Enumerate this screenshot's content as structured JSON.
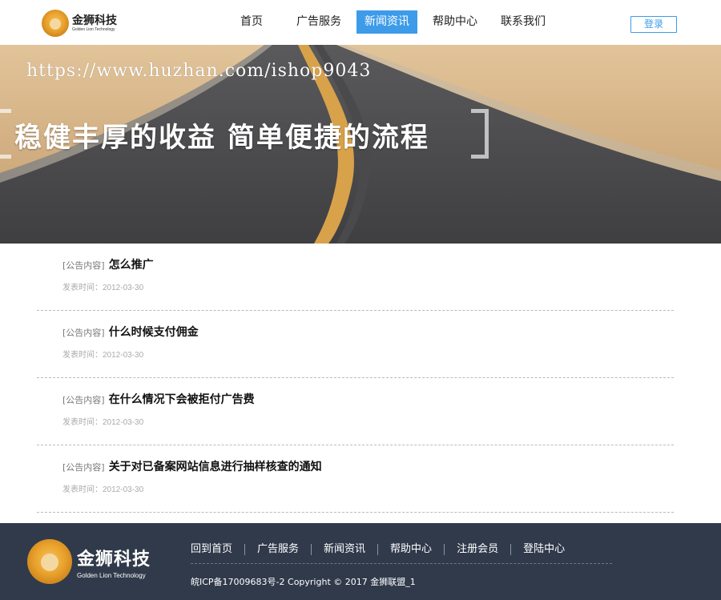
{
  "header": {
    "logo_cn": "金狮科技",
    "logo_en": "Golden Lion Technology",
    "nav": [
      "首页",
      "广告服务",
      "新闻资讯",
      "帮助中心",
      "联系我们"
    ],
    "active_nav": "新闻资讯",
    "login_label": "登录"
  },
  "banner": {
    "watermark": "https://www.huzhan.com/ishop9043",
    "slogan": "稳健丰厚的收益 简单便捷的流程"
  },
  "news": [
    {
      "tag": "[公告内容]",
      "title": "怎么推广",
      "date": "发表时间：2012-03-30"
    },
    {
      "tag": "[公告内容]",
      "title": "什么时候支付佣金",
      "date": "发表时间：2012-03-30"
    },
    {
      "tag": "[公告内容]",
      "title": "在什么情况下会被拒付广告费",
      "date": "发表时间：2012-03-30"
    },
    {
      "tag": "[公告内容]",
      "title": "关于对已备案网站信息进行抽样核查的通知",
      "date": "发表时间：2012-03-30"
    }
  ],
  "footer": {
    "logo_cn": "金狮科技",
    "logo_en": "Golden Lion Technology",
    "links": [
      "回到首页",
      "广告服务",
      "新闻资讯",
      "帮助中心",
      "注册会员",
      "登陆中心"
    ],
    "copyright": "皖ICP备17009683号-2  Copyright © 2017 金狮联盟_1"
  },
  "colors": {
    "accent": "#3d9be9",
    "footer_bg": "#303a4b"
  }
}
